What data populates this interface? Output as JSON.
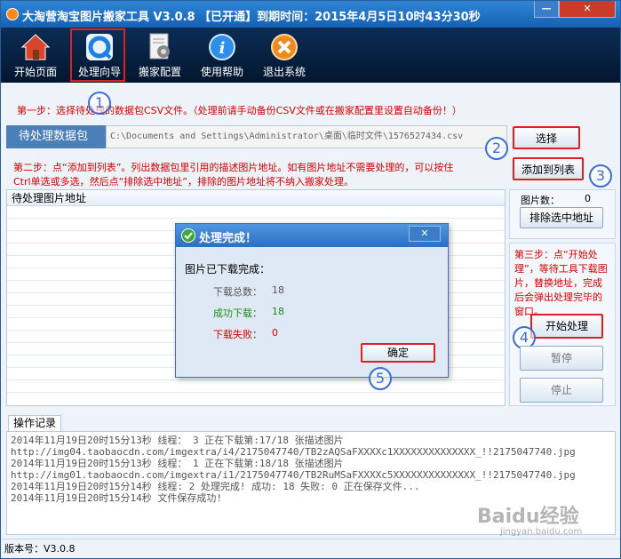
{
  "window": {
    "title": "大淘营淘宝图片搬家工具 V3.0.8 【已开通】到期时间：2015年4月5日10时43分30秒",
    "min_glyph": "—",
    "close_glyph": "✕"
  },
  "toolbar": {
    "items": [
      {
        "label": "开始页面",
        "icon": "home-icon"
      },
      {
        "label": "处理向导",
        "icon": "wizard-icon"
      },
      {
        "label": "搬家配置",
        "icon": "config-icon"
      },
      {
        "label": "使用帮助",
        "icon": "help-icon"
      },
      {
        "label": "退出系统",
        "icon": "exit-icon"
      }
    ]
  },
  "annotations": {
    "n1": "1",
    "n2": "2",
    "n3": "3",
    "n4": "4",
    "n5": "5"
  },
  "step1": "第一步：选择待处理的数据包CSV文件。（处理前请手动备份CSV文件或在搬家配置里设置自动备份！）",
  "csv": {
    "label": "待处理数据包",
    "path": "C:\\Documents and Settings\\Administrator\\桌面\\临时文件\\1576527434.csv",
    "select_button": "选择"
  },
  "step2": {
    "line1": "第二步：点“添加到列表”。列出数据包里引用的描述图片地址。如有图片地址不需要处理的，可以按住",
    "line2": "Ctrl单选或多选，然后点“排除选中地址”，排除的图片地址将不纳入搬家处理。",
    "add_button": "添加到列表"
  },
  "image_list": {
    "header": "待处理图片地址",
    "count_label": "图片数：",
    "count_value": "0",
    "exclude_button": "排除选中地址"
  },
  "step3": "第三步：点“开始处理”，等待工具下载图片，替换地址，完成后会弹出处理完毕的窗口。",
  "actions": {
    "start": "开始处理",
    "pause": "暂停",
    "stop": "停止"
  },
  "dialog": {
    "title": "处理完成！",
    "heading": "图片已下载完成：",
    "total_label": "下载总数：",
    "total_value": "18",
    "success_label": "成功下载：",
    "success_value": "18",
    "fail_label": "下载失败：",
    "fail_value": "0",
    "ok_button": "确定",
    "colors": {
      "success": "#1a8a1a",
      "fail": "#d40000"
    }
  },
  "log": {
    "tab": "操作记录",
    "lines": [
      "2014年11月19日20时15分13秒 线程： 3  正在下载第:17/18 张描述图片",
      "http://img04.taobaocdn.com/imgextra/i4/2175047740/TB2zAQSaFXXXXc1XXXXXXXXXXXXXX_!!2175047740.jpg",
      "2014年11月19日20时15分13秒 线程： 1  正在下载第:18/18 张描述图片",
      "http://img01.taobaocdn.com/imgextra/i1/2175047740/TB2RuMSaFXXXXc5XXXXXXXXXXXXXX_!!2175047740.jpg",
      "2014年11月19日20时15分14秒 线程: 2 处理完成! 成功:  18 失败: 0 正在保存文件...",
      "2014年11月19日20时15分14秒 文件保存成功!"
    ]
  },
  "status": "版本号：V3.0.8",
  "watermark": {
    "brand": "Baidu经验",
    "url": "jingyan.baidu.com"
  }
}
